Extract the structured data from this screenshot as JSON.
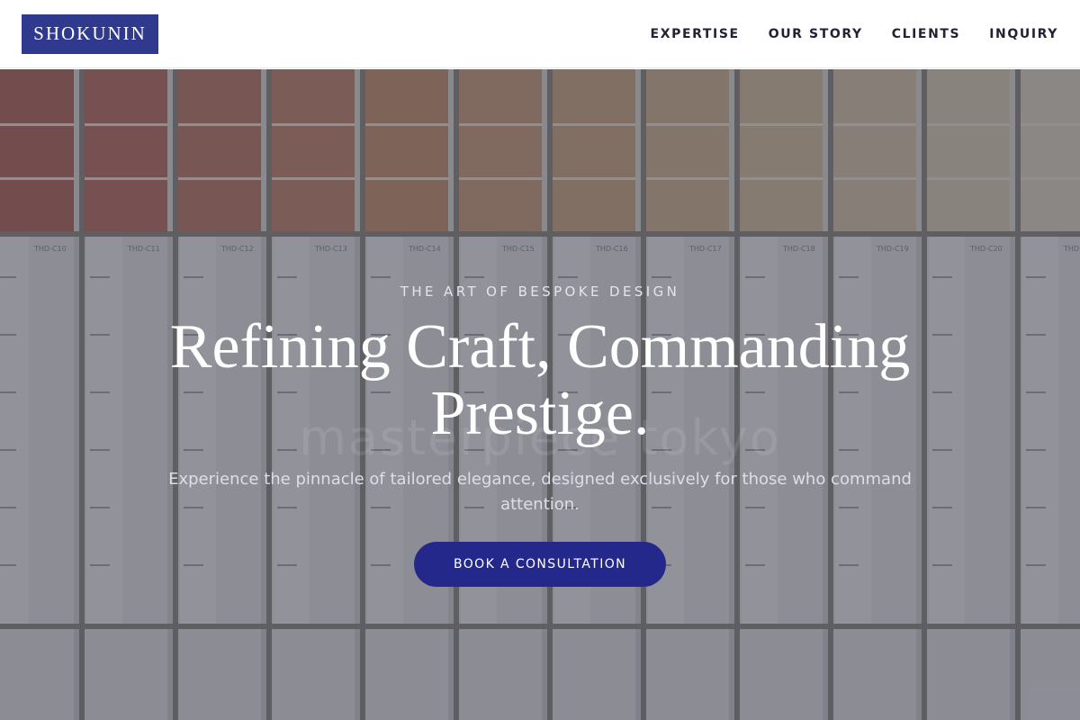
{
  "brand": {
    "name": "SHOKUNIN",
    "color": "#2f3a8f"
  },
  "nav": {
    "items": [
      {
        "label": "EXPERTISE"
      },
      {
        "label": "OUR STORY"
      },
      {
        "label": "CLIENTS"
      },
      {
        "label": "INQUIRY"
      }
    ]
  },
  "hero": {
    "eyebrow": "THE ART OF BESPOKE DESIGN",
    "headline": "Refining Craft, Commanding Prestige.",
    "watermark": "masterpiece tokyo",
    "subtext": "Experience the pinnacle of tailored elegance, designed exclusively for those who command attention.",
    "cta_label": "BOOK A CONSULTATION",
    "cta_color": "#24288a",
    "background": "paint-swatch-cards-photo",
    "swatch_labels": [
      "THD-C10",
      "THD-C11",
      "THD-C12",
      "THD-C13",
      "THD-C14",
      "THD-C15",
      "THD-C16",
      "THD-C17",
      "THD-C18",
      "THD-C19",
      "THD-C20"
    ]
  }
}
